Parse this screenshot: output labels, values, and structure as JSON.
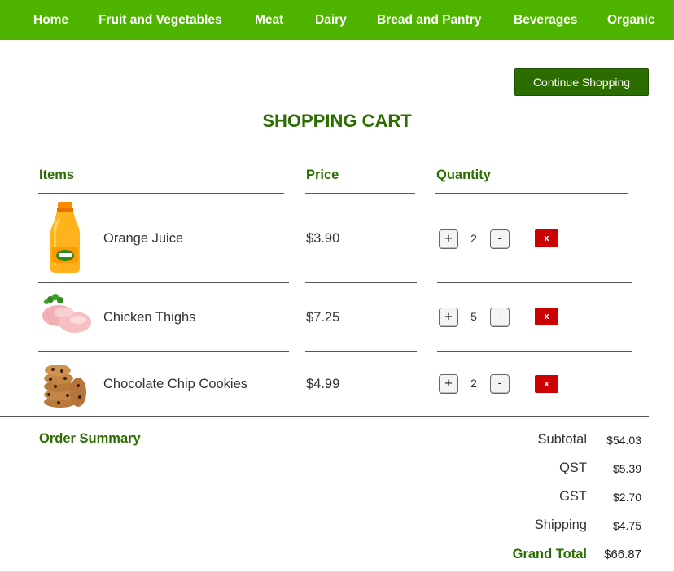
{
  "nav": {
    "items": [
      "Home",
      "Fruit and Vegetables",
      "Meat",
      "Dairy",
      "Bread and Pantry",
      "Beverages",
      "Organic"
    ]
  },
  "continue_button": "Continue Shopping",
  "cart_title": "SHOPPING CART",
  "columns": {
    "items": "Items",
    "price": "Price",
    "quantity": "Quantity"
  },
  "products": [
    {
      "name": "Orange Juice",
      "price": "$3.90",
      "quantity": "2",
      "image": "orange-juice-bottle"
    },
    {
      "name": "Chicken Thighs",
      "price": "$7.25",
      "quantity": "5",
      "image": "raw-chicken"
    },
    {
      "name": "Chocolate Chip Cookies",
      "price": "$4.99",
      "quantity": "2",
      "image": "cookie-stack"
    }
  ],
  "controls": {
    "plus": "+",
    "minus": "-",
    "remove": "x"
  },
  "summary": {
    "title": "Order Summary",
    "rows": [
      {
        "label": "Subtotal",
        "value": "$54.03"
      },
      {
        "label": "QST",
        "value": "$5.39"
      },
      {
        "label": "GST",
        "value": "$2.70"
      },
      {
        "label": "Shipping",
        "value": "$4.75"
      }
    ],
    "grand_total": {
      "label": "Grand Total",
      "value": "$66.87"
    }
  },
  "colors": {
    "nav_bg": "#4fb400",
    "brand_green": "#2c6d00",
    "remove_red": "#cc0000"
  }
}
